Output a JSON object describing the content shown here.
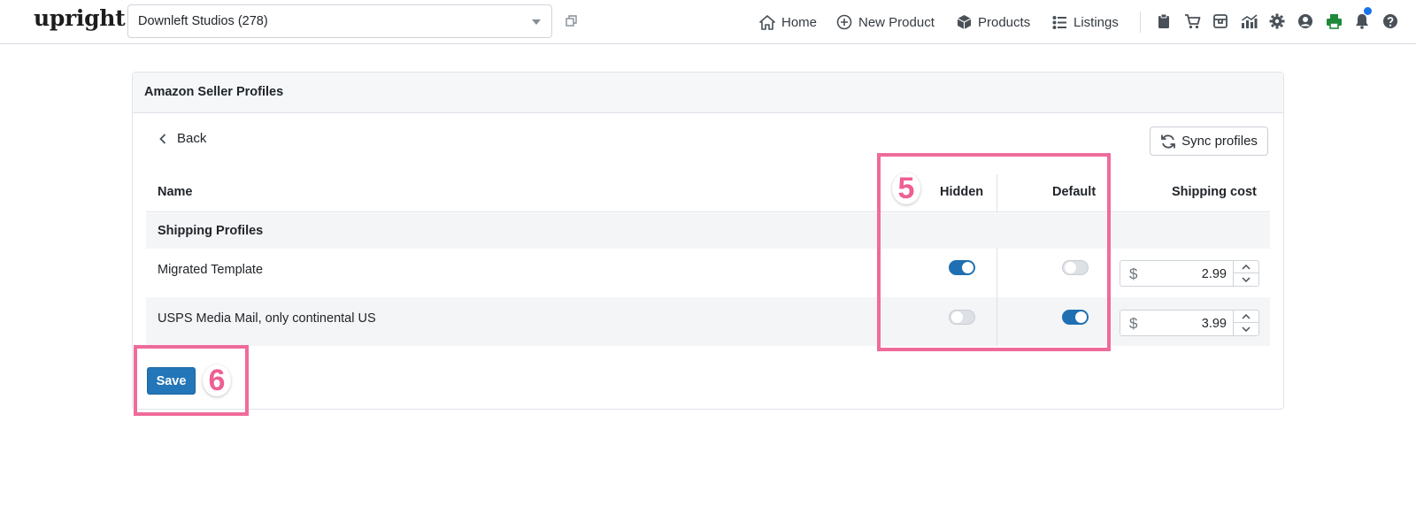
{
  "app": {
    "logo_text": "upright"
  },
  "store_selector": {
    "value": "Downleft Studios (278)"
  },
  "nav": {
    "home": "Home",
    "new_product": "New Product",
    "products": "Products",
    "listings": "Listings"
  },
  "toolbar_icons": [
    "clipboard-icon",
    "cart-icon",
    "store-icon",
    "chart-icon",
    "gear-icon",
    "user-circle-icon",
    "printer-icon",
    "bell-icon",
    "help-icon"
  ],
  "card": {
    "title": "Amazon Seller Profiles",
    "back_label": "Back",
    "sync_label": "Sync profiles"
  },
  "table": {
    "headers": {
      "name": "Name",
      "hidden": "Hidden",
      "default": "Default",
      "shipping_cost": "Shipping cost"
    },
    "group_label": "Shipping Profiles",
    "rows": [
      {
        "name": "Migrated Template",
        "hidden": true,
        "default": false,
        "currency": "$",
        "shipping_cost": "2.99"
      },
      {
        "name": "USPS Media Mail, only continental US",
        "hidden": false,
        "default": true,
        "currency": "$",
        "shipping_cost": "3.99"
      }
    ]
  },
  "actions": {
    "save_label": "Save"
  },
  "annotations": {
    "step_5": "5",
    "step_6": "6"
  },
  "colors": {
    "primary": "#2376b7",
    "toggle_on": "#1f6fb2",
    "highlight": "#ef6b9b",
    "printer": "#1e8a3a",
    "notification": "#1a73e8"
  }
}
